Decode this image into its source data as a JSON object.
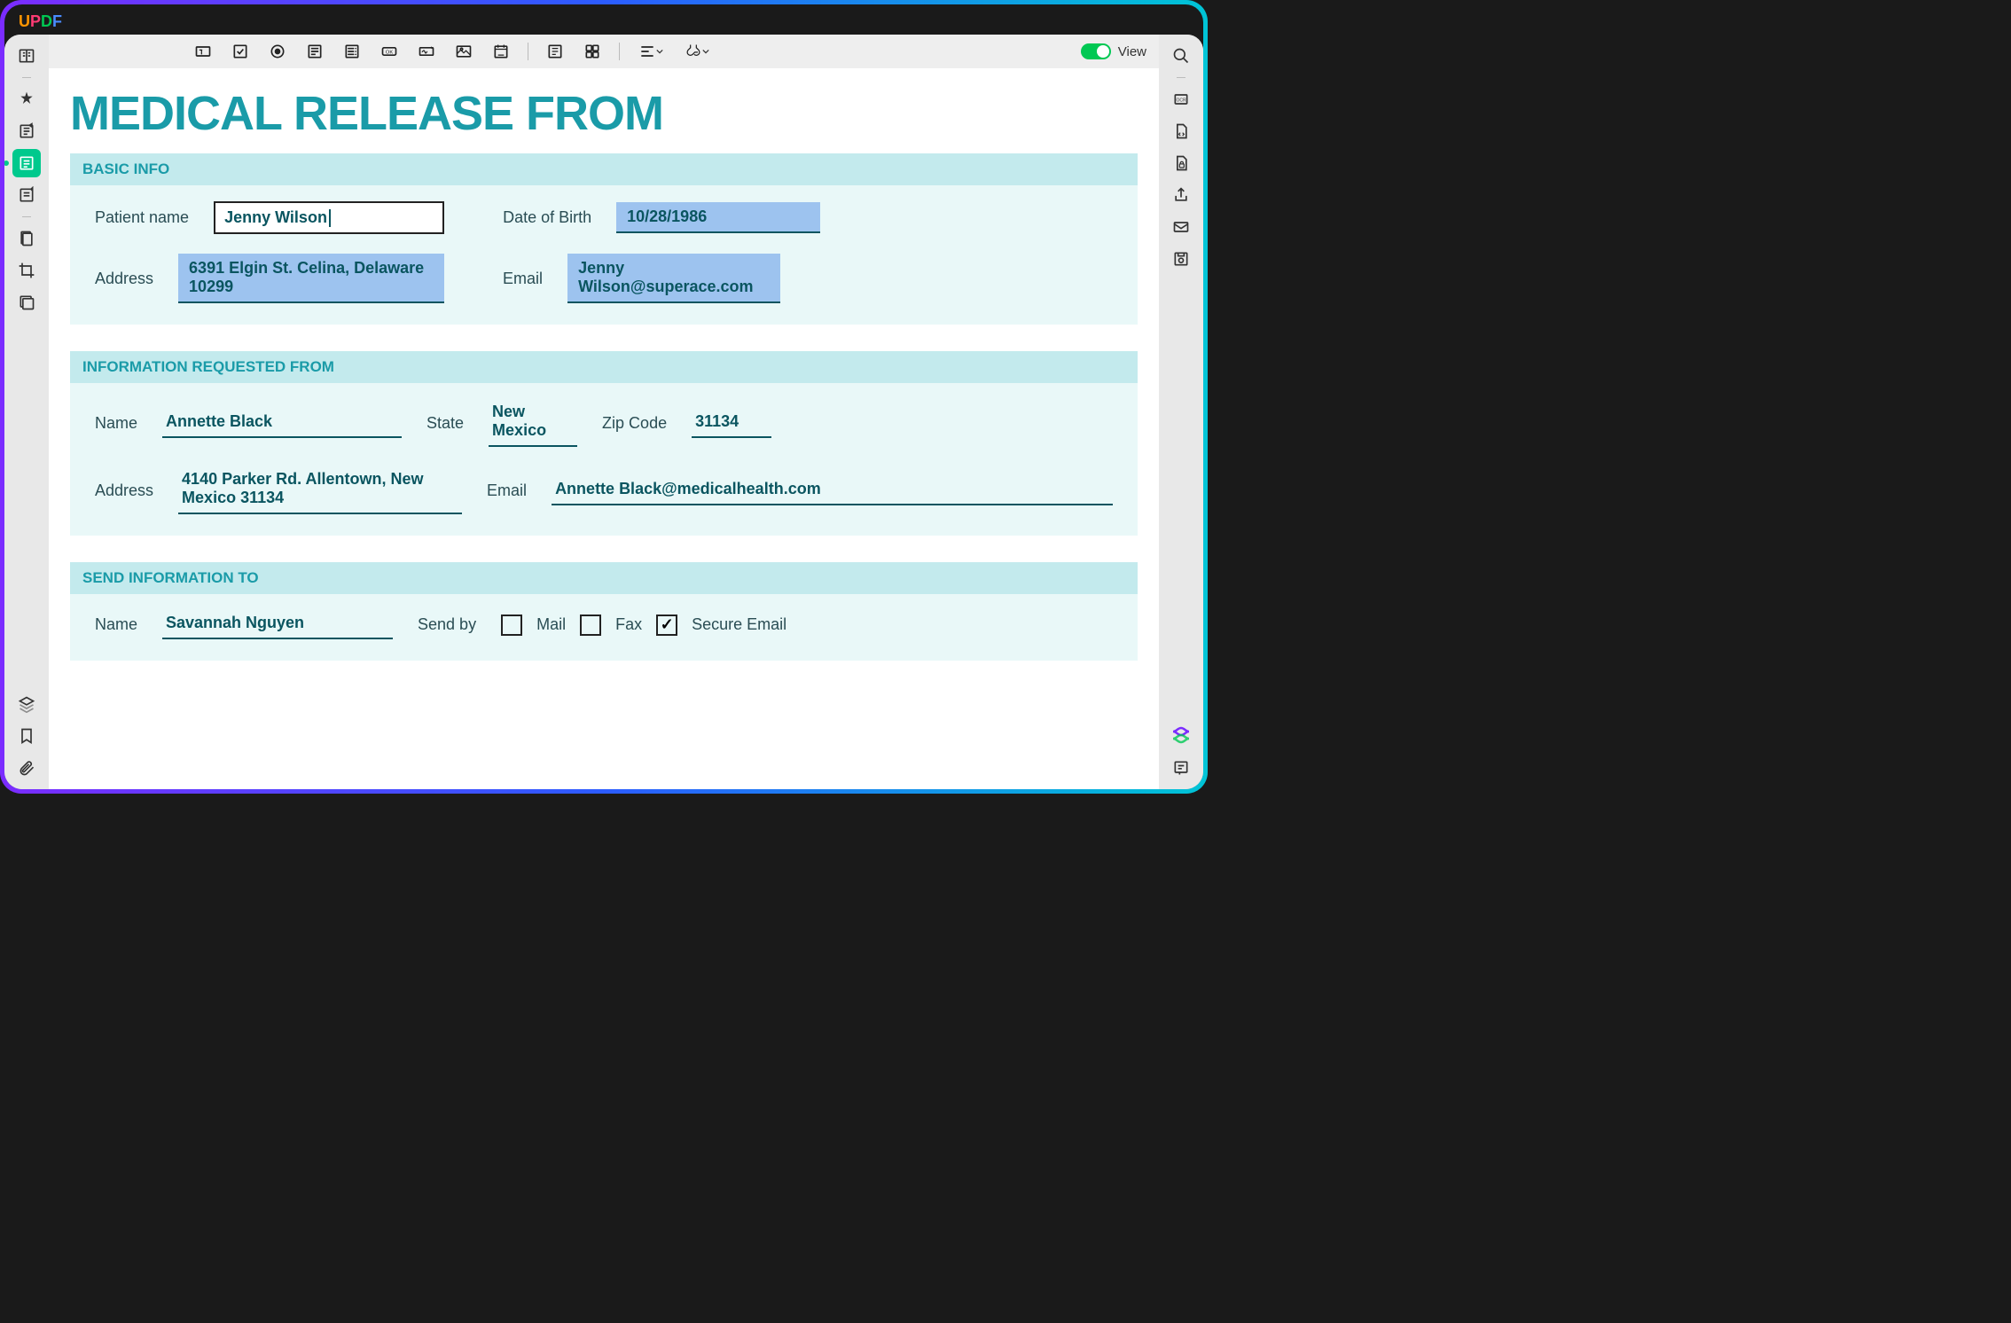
{
  "app": {
    "logo": "UPDF"
  },
  "toolbar": {
    "view_label": "View"
  },
  "document": {
    "title": "MEDICAL RELEASE FROM",
    "basic_info": {
      "header": "BASIC INFO",
      "patient_name_label": "Patient name",
      "patient_name": "Jenny Wilson",
      "dob_label": "Date of Birth",
      "dob": "10/28/1986",
      "address_label": "Address",
      "address": "6391 Elgin St. Celina, Delaware 10299",
      "email_label": "Email",
      "email": "Jenny Wilson@superace.com"
    },
    "requested_from": {
      "header": "INFORMATION REQUESTED FROM",
      "name_label": "Name",
      "name": "Annette Black",
      "state_label": "State",
      "state": "New Mexico",
      "zip_label": "Zip Code",
      "zip": "31134",
      "address_label": "Address",
      "address": "4140 Parker Rd. Allentown, New Mexico 31134",
      "email_label": "Email",
      "email": "Annette Black@medicalhealth.com"
    },
    "send_to": {
      "header": "SEND INFORMATION TO",
      "name_label": "Name",
      "name": "Savannah Nguyen",
      "send_by_label": "Send by",
      "mail": "Mail",
      "fax": "Fax",
      "secure_email": "Secure Email",
      "mail_checked": false,
      "fax_checked": false,
      "secure_email_checked": true
    }
  }
}
